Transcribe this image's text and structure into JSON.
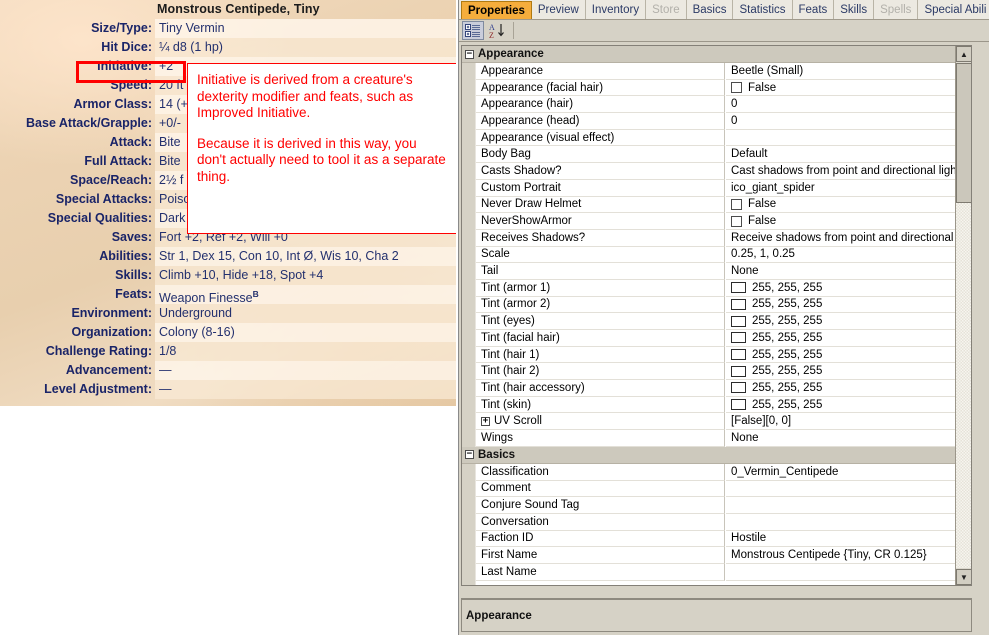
{
  "statblock": {
    "title": "Monstrous Centipede, Tiny",
    "rows": [
      {
        "label": "Size/Type:",
        "value": "Tiny Vermin"
      },
      {
        "label": "Hit Dice:",
        "value": "¼ d8 (1 hp)"
      },
      {
        "label": "Initiative:",
        "value": "+2",
        "highlighted": true
      },
      {
        "label": "Speed:",
        "value": "20 ft"
      },
      {
        "label": "Armor Class:",
        "value": "14 (+"
      },
      {
        "label": "Base Attack/Grapple:",
        "value": "+0/-"
      },
      {
        "label": "Attack:",
        "value": "Bite"
      },
      {
        "label": "Full Attack:",
        "value": "Bite"
      },
      {
        "label": "Space/Reach:",
        "value": "2½ f"
      },
      {
        "label": "Special Attacks:",
        "value": "Poiso"
      },
      {
        "label": "Special Qualities:",
        "value": "Dark"
      },
      {
        "label": "Saves:",
        "value": "Fort +2, Ref +2, Will +0"
      },
      {
        "label": "Abilities:",
        "value": "Str 1, Dex 15, Con 10, Int Ø, Wis 10, Cha 2"
      },
      {
        "label": "Skills:",
        "value": "Climb +10, Hide +18, Spot +4"
      },
      {
        "label": "Feats:",
        "value": "Weapon Finesse",
        "sup": "B"
      },
      {
        "label": "Environment:",
        "value": "Underground"
      },
      {
        "label": "Organization:",
        "value": "Colony (8-16)"
      },
      {
        "label": "Challenge Rating:",
        "value": "1/8"
      },
      {
        "label": "Advancement:",
        "value": "—"
      },
      {
        "label": "Level Adjustment:",
        "value": "—"
      }
    ]
  },
  "callout": {
    "color": "#ff0000",
    "paragraphs": [
      "Initiative is derived from a creature's dexterity modifier and feats, such as Improved Initiative.",
      "Because it is derived in this way, you don't actually need to tool it as a separate thing."
    ]
  },
  "inspector": {
    "tabs": [
      {
        "label": "Properties",
        "state": "active"
      },
      {
        "label": "Preview",
        "state": "normal"
      },
      {
        "label": "Inventory",
        "state": "normal"
      },
      {
        "label": "Store",
        "state": "disabled"
      },
      {
        "label": "Basics",
        "state": "normal"
      },
      {
        "label": "Statistics",
        "state": "normal"
      },
      {
        "label": "Feats",
        "state": "normal"
      },
      {
        "label": "Skills",
        "state": "normal"
      },
      {
        "label": "Spells",
        "state": "disabled"
      },
      {
        "label": "Special Abili",
        "state": "normal"
      }
    ],
    "tabnav": {
      "prev_icon": "◁",
      "next_icon": "▶",
      "close_icon": "✕"
    },
    "toolbar": {
      "categorized_label": "categorized-view",
      "alphabetical_label": "alphabetical-sort",
      "az_top": "A",
      "az_bottom": "Z",
      "az_arrow": "↓"
    },
    "accent_color": "#f5ad3c",
    "rows": [
      {
        "type": "category",
        "name": "Appearance",
        "expander": "−"
      },
      {
        "type": "prop",
        "name": "Appearance",
        "value": "Beetle (Small)"
      },
      {
        "type": "prop",
        "name": "Appearance (facial hair)",
        "value": "False",
        "widget": "checkbox"
      },
      {
        "type": "prop",
        "name": "Appearance (hair)",
        "value": "0"
      },
      {
        "type": "prop",
        "name": "Appearance (head)",
        "value": "0"
      },
      {
        "type": "prop",
        "name": "Appearance (visual effect)",
        "value": ""
      },
      {
        "type": "prop",
        "name": "Body Bag",
        "value": "Default"
      },
      {
        "type": "prop",
        "name": "Casts Shadow?",
        "value": "Cast shadows from point and directional lights"
      },
      {
        "type": "prop",
        "name": "Custom Portrait",
        "value": "ico_giant_spider"
      },
      {
        "type": "prop",
        "name": "Never Draw Helmet",
        "value": "False",
        "widget": "checkbox"
      },
      {
        "type": "prop",
        "name": "NeverShowArmor",
        "value": "False",
        "widget": "checkbox"
      },
      {
        "type": "prop",
        "name": "Receives Shadows?",
        "value": "Receive shadows from point and directional lights"
      },
      {
        "type": "prop",
        "name": "Scale",
        "value": "0.25, 1, 0.25"
      },
      {
        "type": "prop",
        "name": "Tail",
        "value": "None"
      },
      {
        "type": "prop",
        "name": "Tint (armor 1)",
        "value": "255, 255, 255",
        "widget": "swatch",
        "swatch_color": "#ffffff"
      },
      {
        "type": "prop",
        "name": "Tint (armor 2)",
        "value": "255, 255, 255",
        "widget": "swatch",
        "swatch_color": "#ffffff"
      },
      {
        "type": "prop",
        "name": "Tint (eyes)",
        "value": "255, 255, 255",
        "widget": "swatch",
        "swatch_color": "#ffffff"
      },
      {
        "type": "prop",
        "name": "Tint (facial hair)",
        "value": "255, 255, 255",
        "widget": "swatch",
        "swatch_color": "#ffffff"
      },
      {
        "type": "prop",
        "name": "Tint (hair 1)",
        "value": "255, 255, 255",
        "widget": "swatch",
        "swatch_color": "#ffffff"
      },
      {
        "type": "prop",
        "name": "Tint (hair 2)",
        "value": "255, 255, 255",
        "widget": "swatch",
        "swatch_color": "#ffffff"
      },
      {
        "type": "prop",
        "name": "Tint (hair accessory)",
        "value": "255, 255, 255",
        "widget": "swatch",
        "swatch_color": "#ffffff"
      },
      {
        "type": "prop",
        "name": "Tint (skin)",
        "value": "255, 255, 255",
        "widget": "swatch",
        "swatch_color": "#ffffff"
      },
      {
        "type": "prop",
        "name": "UV Scroll",
        "value": "[False][0, 0]",
        "expander": "+"
      },
      {
        "type": "prop",
        "name": "Wings",
        "value": "None"
      },
      {
        "type": "category",
        "name": "Basics",
        "expander": "−"
      },
      {
        "type": "prop",
        "name": "Classification",
        "value": "0_Vermin_Centipede"
      },
      {
        "type": "prop",
        "name": "Comment",
        "value": ""
      },
      {
        "type": "prop",
        "name": "Conjure Sound Tag",
        "value": ""
      },
      {
        "type": "prop",
        "name": "Conversation",
        "value": ""
      },
      {
        "type": "prop",
        "name": "Faction ID",
        "value": "Hostile"
      },
      {
        "type": "prop",
        "name": "First Name",
        "value": "Monstrous Centipede {Tiny, CR 0.125}"
      },
      {
        "type": "prop",
        "name": "Last Name",
        "value": ""
      }
    ],
    "scrollbar": {
      "up_icon": "▲",
      "down_icon": "▼"
    },
    "statusbar": {
      "text": "Appearance"
    }
  }
}
